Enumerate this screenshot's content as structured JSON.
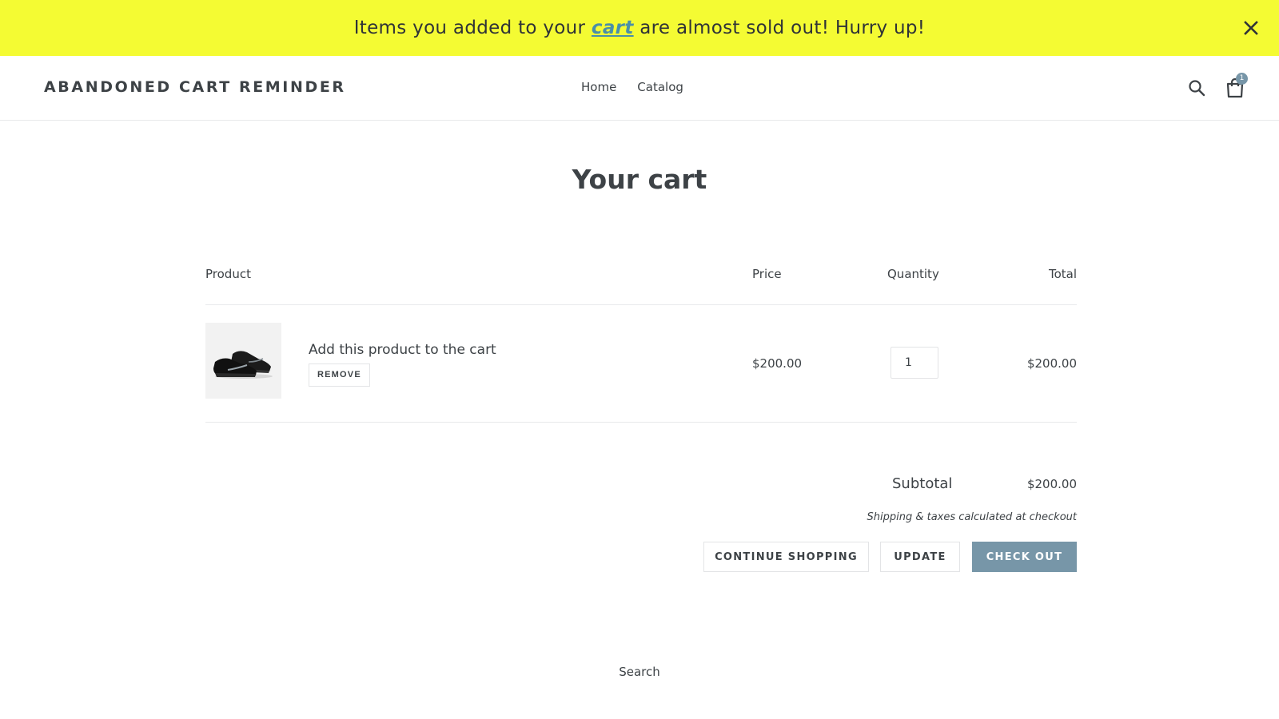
{
  "banner": {
    "text_before": "Items you added to your ",
    "link_text": "cart",
    "text_after": " are almost sold out! Hurry up!",
    "background_color": "#f4fb33",
    "close_icon": "close-icon"
  },
  "header": {
    "logo": "ABANDONED CART REMINDER",
    "nav": [
      {
        "label": "Home"
      },
      {
        "label": "Catalog"
      }
    ],
    "search_icon": "search-icon",
    "cart_icon": "shopping-bag-icon",
    "cart_count": "1"
  },
  "page": {
    "title": "Your cart"
  },
  "cart_table": {
    "columns": [
      "Product",
      "Price",
      "Quantity",
      "Total"
    ],
    "items": [
      {
        "image": "black-sneaker-image",
        "name": "Add this product to the cart",
        "remove_label": "REMOVE",
        "price": "$200.00",
        "quantity": "1",
        "total": "$200.00"
      }
    ]
  },
  "summary": {
    "subtotal_label": "Subtotal",
    "subtotal_value": "$200.00",
    "shipping_note": "Shipping & taxes calculated at checkout"
  },
  "actions": {
    "continue_label": "CONTINUE SHOPPING",
    "update_label": "UPDATE",
    "checkout_label": "CHECK OUT",
    "accent_color": "#7796a8"
  },
  "footer": {
    "search_link": "Search"
  }
}
